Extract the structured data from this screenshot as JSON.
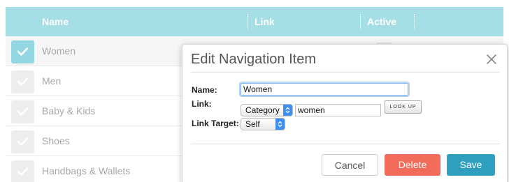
{
  "table": {
    "headers": {
      "name": "Name",
      "link": "Link",
      "active": "Active"
    },
    "rows": [
      {
        "name": "Women",
        "selected": true
      },
      {
        "name": "Men",
        "selected": false
      },
      {
        "name": "Baby & Kids",
        "selected": false
      },
      {
        "name": "Shoes",
        "selected": false
      },
      {
        "name": "Handbags & Wallets",
        "selected": false
      }
    ]
  },
  "modal": {
    "title": "Edit Navigation Item",
    "name_label": "Name:",
    "name_value": "Women",
    "link_label": "Link:",
    "link_type_selected": "Category",
    "link_value": "women",
    "lookup_label": "LOOK UP",
    "link_target_label": "Link Target:",
    "link_target_selected": "Self",
    "buttons": {
      "cancel": "Cancel",
      "delete": "Delete",
      "save": "Save"
    }
  },
  "icons": {
    "close": "close-icon",
    "check": "check-icon",
    "select_arrow": "select-updown-icon"
  },
  "colors": {
    "header_bg": "#a6dee6",
    "checkbox_on": "#92d6e1",
    "delete": "#f26b5b",
    "save": "#2f9fbf",
    "select_accent": "#3d8ff2"
  }
}
